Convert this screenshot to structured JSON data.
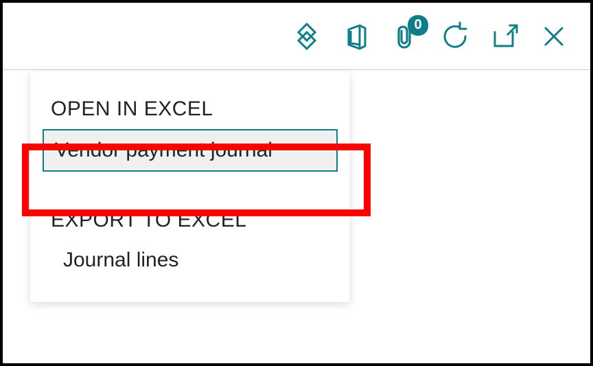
{
  "toolbar": {
    "attachment_badge": "0"
  },
  "panel": {
    "open_in_excel_header": "OPEN IN EXCEL",
    "open_in_excel_items": [
      {
        "label": "Vendor payment journal"
      }
    ],
    "export_to_excel_header": "EXPORT TO EXCEL",
    "export_to_excel_items": [
      {
        "label": "Journal lines"
      }
    ]
  }
}
